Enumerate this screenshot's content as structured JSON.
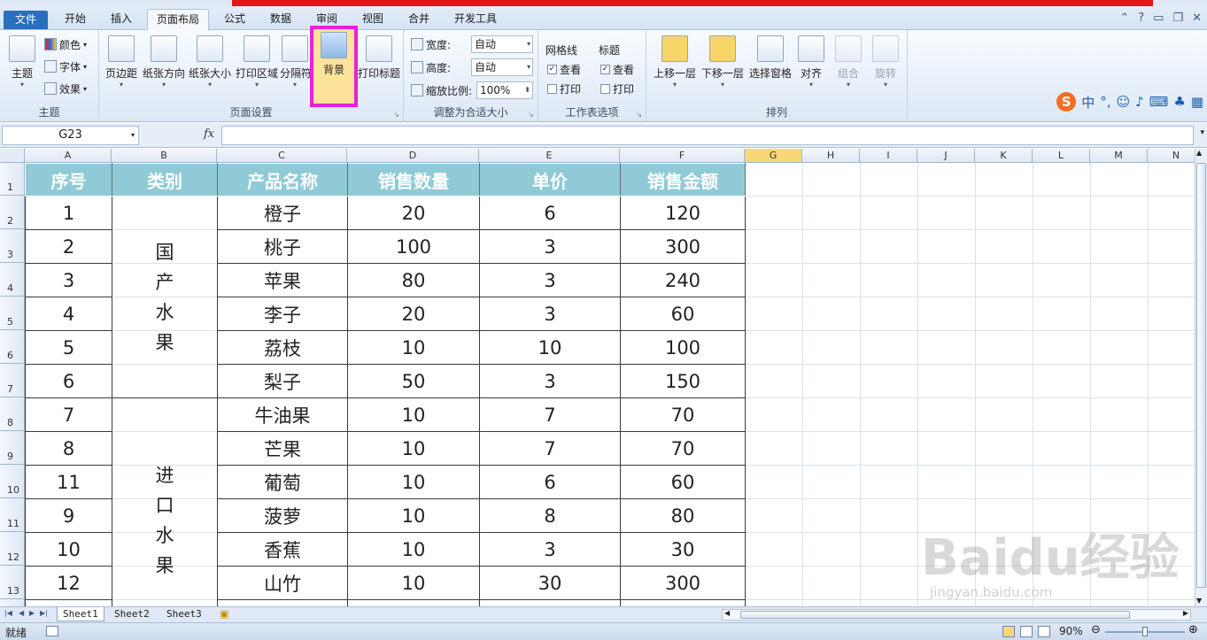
{
  "menu_tabs": [
    "文件",
    "开始",
    "插入",
    "页面布局",
    "公式",
    "数据",
    "审阅",
    "视图",
    "合并",
    "开发工具"
  ],
  "ribbon": {
    "theme_group": {
      "label": "主题",
      "theme_btn": "主题",
      "colors": "颜色",
      "fonts": "字体",
      "effects": "效果"
    },
    "page_setup_group": {
      "label": "页面设置",
      "margins": "页边距",
      "orientation": "纸张方向",
      "size": "纸张大小",
      "print_area": "打印区域",
      "breaks": "分隔符",
      "background": "背景",
      "print_titles": "打印标题"
    },
    "scale_group": {
      "label": "调整为合适大小",
      "width_label": "宽度:",
      "width_value": "自动",
      "height_label": "高度:",
      "height_value": "自动",
      "scale_label": "缩放比例:",
      "scale_value": "100%"
    },
    "sheet_options_group": {
      "label": "工作表选项",
      "gridlines": "网格线",
      "headings": "标题",
      "view": "查看",
      "print": "打印"
    },
    "arrange_group": {
      "label": "排列",
      "bring_forward": "上移一层",
      "send_backward": "下移一层",
      "selection_pane": "选择窗格",
      "align": "对齐",
      "group": "组合",
      "rotate": "旋转"
    }
  },
  "name_box": "G23",
  "fx": "fx",
  "columns": [
    "A",
    "B",
    "C",
    "D",
    "E",
    "F",
    "G",
    "H",
    "I",
    "J",
    "K",
    "L",
    "M",
    "N"
  ],
  "rows": [
    "1",
    "2",
    "3",
    "4",
    "5",
    "6",
    "7",
    "8",
    "9",
    "10",
    "11",
    "12",
    "13"
  ],
  "table": {
    "headers": [
      "序号",
      "类别",
      "产品名称",
      "销售数量",
      "单价",
      "销售金额"
    ],
    "category1": [
      "国",
      "产",
      "水",
      "果"
    ],
    "category2": [
      "进",
      "口",
      "水",
      "果"
    ],
    "rows": [
      [
        "1",
        "橙子",
        "20",
        "6",
        "120"
      ],
      [
        "2",
        "桃子",
        "100",
        "3",
        "300"
      ],
      [
        "3",
        "苹果",
        "80",
        "3",
        "240"
      ],
      [
        "4",
        "李子",
        "20",
        "3",
        "60"
      ],
      [
        "5",
        "荔枝",
        "10",
        "10",
        "100"
      ],
      [
        "6",
        "梨子",
        "50",
        "3",
        "150"
      ],
      [
        "7",
        "牛油果",
        "10",
        "7",
        "70"
      ],
      [
        "8",
        "芒果",
        "10",
        "7",
        "70"
      ],
      [
        "11",
        "葡萄",
        "10",
        "6",
        "60"
      ],
      [
        "9",
        "菠萝",
        "10",
        "8",
        "80"
      ],
      [
        "10",
        "香蕉",
        "10",
        "3",
        "30"
      ],
      [
        "12",
        "山竹",
        "10",
        "30",
        "300"
      ]
    ]
  },
  "sheets": [
    "Sheet1",
    "Sheet2",
    "Sheet3"
  ],
  "status": "就绪",
  "zoom": "90%",
  "watermark": "Baidu经验",
  "watermark_url": "jingyan.baidu.com"
}
